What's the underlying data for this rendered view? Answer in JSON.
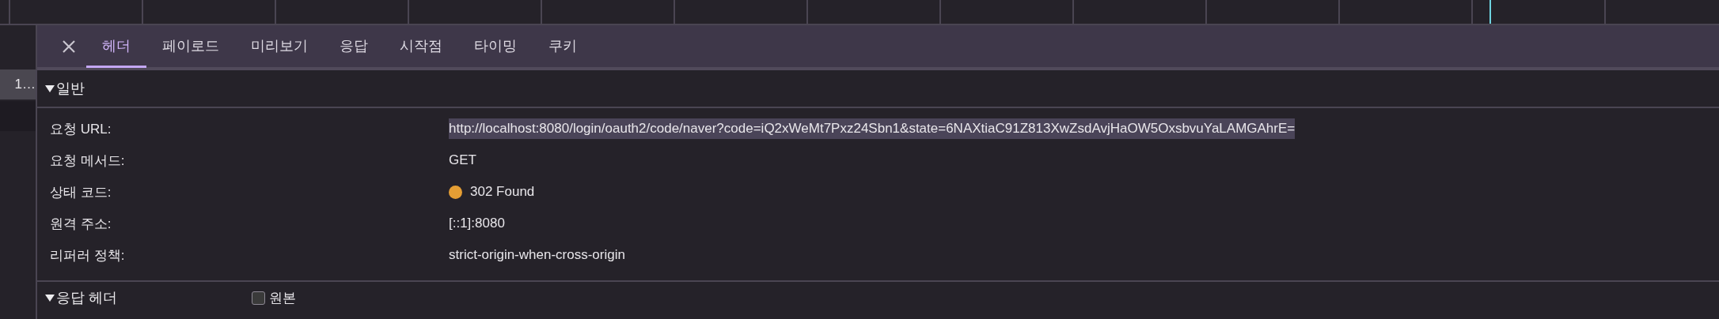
{
  "sidebar": {
    "items": [
      {
        "label": "1…",
        "selected": true
      },
      {
        "selected": false
      }
    ]
  },
  "tabs": [
    {
      "label": "헤더",
      "selected": true
    },
    {
      "label": "페이로드",
      "selected": false
    },
    {
      "label": "미리보기",
      "selected": false
    },
    {
      "label": "응답",
      "selected": false
    },
    {
      "label": "시작점",
      "selected": false
    },
    {
      "label": "타이밍",
      "selected": false
    },
    {
      "label": "쿠키",
      "selected": false
    }
  ],
  "general": {
    "title": "일반",
    "expanded": true,
    "rows": [
      {
        "label": "요청 URL:",
        "value": "http://localhost:8080/login/oauth2/code/naver?code=iQ2xWeMt7Pxz24Sbn1&state=6NAXtiaC91Z813XwZsdAvjHaOW5OxsbvuYaLAMGAhrE=",
        "highlighted": true
      },
      {
        "label": "요청 메서드:",
        "value": "GET",
        "highlighted": false
      },
      {
        "label": "상태 코드:",
        "value": "302 Found",
        "highlighted": false,
        "color": "#e59e34"
      },
      {
        "label": "원격 주소:",
        "value": "[::1]:8080",
        "highlighted": false
      },
      {
        "label": "리퍼러 정책:",
        "value": "strict-origin-when-cross-origin",
        "highlighted": false
      }
    ]
  },
  "response_headers": {
    "title": "응답 헤더",
    "expanded": true,
    "raw": {
      "label": "원본",
      "checked": false
    }
  }
}
